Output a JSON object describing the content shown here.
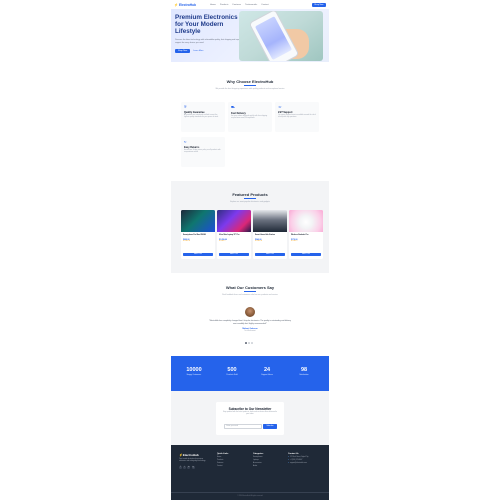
{
  "nav": {
    "logo_icon": "bolt-icon",
    "brand": "ElectroHub",
    "links": [
      "Home",
      "Products",
      "Features",
      "Testimonials",
      "Contact"
    ],
    "cta": "Shop Now"
  },
  "hero": {
    "title": "Premium Electronics for Your Modern Lifestyle",
    "subtitle": "Discover the latest technology with unbeatable quality, fast shipping and expert support for every device you need.",
    "primary_btn": "Shop Now",
    "secondary_btn": "Learn More"
  },
  "features": {
    "title": "Why Choose ElectroHub",
    "subtitle": "We provide the best shopping experience with quality products and exceptional service",
    "cards": [
      {
        "icon": "shield-icon",
        "title": "Quality Guarantee",
        "desc": "All products are tested and certified to meet the highest quality standards for your peace of mind."
      },
      {
        "icon": "truck-icon",
        "title": "Fast Delivery",
        "desc": "Get your orders delivered quickly with free shipping on purchases over $50 anywhere."
      },
      {
        "icon": "headset-icon",
        "title": "24/7 Support",
        "desc": "Our expert support team is available around the clock to help with any questions."
      },
      {
        "icon": "refresh-icon",
        "title": "Easy Returns",
        "desc": "Hassle-free 30-day return policy on all products with no questions asked."
      }
    ]
  },
  "products": {
    "title": "Featured Products",
    "subtitle": "Explore our most popular electronics and gadgets",
    "items": [
      {
        "name": "Smartphone Pro Max 256GB",
        "price": "$999.00",
        "rating": "★★★★★",
        "button": "Add to Cart"
      },
      {
        "name": "Ultra Slim Laptop 15\" Pro",
        "price": "$1,299.00",
        "rating": "★★★★☆",
        "button": "Add to Cart"
      },
      {
        "name": "Smart Home Hub Station",
        "price": "$249.00",
        "rating": "★★★★★",
        "button": "Add to Cart"
      },
      {
        "name": "Wireless Earbuds Pro",
        "price": "$179.00",
        "rating": "★★★★☆",
        "button": "Add to Cart"
      }
    ]
  },
  "testimonials": {
    "title": "What Our Customers Say",
    "subtitle": "Real feedback from real customers who love our products and service",
    "quote": "\"ElectroHub has completely changed how I shop for electronics. The quality is outstanding and delivery was incredibly fast. Highly recommended!\"",
    "name": "Michael Johnson",
    "role": "Tech Enthusiast"
  },
  "stats": [
    {
      "value": "10000",
      "label": "Happy Customers"
    },
    {
      "value": "500",
      "label": "Products Sold"
    },
    {
      "value": "24",
      "label": "Support Hours"
    },
    {
      "value": "98",
      "label": "Satisfaction"
    }
  ],
  "newsletter": {
    "title": "Subscribe to Our Newsletter",
    "subtitle": "Stay updated with the latest products, deals and exclusive offers delivered to your inbox.",
    "placeholder": "Enter your email",
    "button": "Subscribe"
  },
  "footer": {
    "brand": "ElectroHub",
    "desc": "Your trusted destination for premium electronics and cutting-edge technology.",
    "social": [
      "f",
      "t",
      "in",
      "ig"
    ],
    "col1": {
      "head": "Quick Links",
      "links": [
        "Home",
        "Products",
        "Features",
        "Contact"
      ]
    },
    "col2": {
      "head": "Categories",
      "links": [
        "Smartphones",
        "Laptops",
        "Accessories",
        "Audio"
      ]
    },
    "col3": {
      "head": "Contact Us",
      "items": [
        "123 Tech Street, Digital City",
        "+1 (555) 123-4567",
        "support@electrohub.com"
      ]
    },
    "copyright": "© 2024 ElectroHub. All rights reserved."
  },
  "colors": {
    "accent": "#2563eb",
    "footer_bg": "#1f2937",
    "section_bg": "#f3f4f6"
  }
}
